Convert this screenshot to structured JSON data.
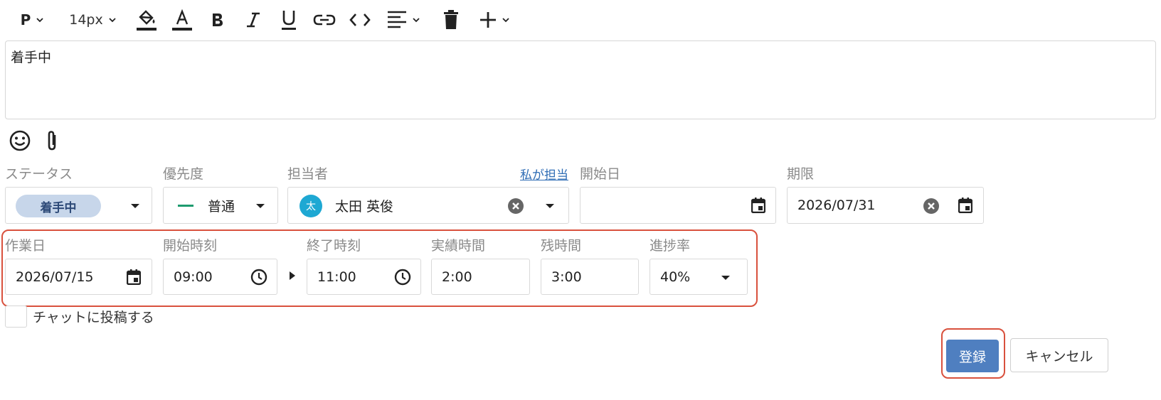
{
  "toolbar": {
    "paragraph_label": "P",
    "font_size_label": "14px"
  },
  "editor": {
    "content": "着手中"
  },
  "fields": {
    "status": {
      "label": "ステータス",
      "value": "着手中"
    },
    "priority": {
      "label": "優先度",
      "value": "普通"
    },
    "assignee": {
      "label": "担当者",
      "link": "私が担当",
      "avatar_initial": "太",
      "value": "太田 英俊"
    },
    "start_date": {
      "label": "開始日",
      "value": ""
    },
    "due_date": {
      "label": "期限",
      "value": "2026/07/31"
    },
    "work_date": {
      "label": "作業日",
      "value": "2026/07/15"
    },
    "start_time": {
      "label": "開始時刻",
      "value": "09:00"
    },
    "end_time": {
      "label": "終了時刻",
      "value": "11:00"
    },
    "actual_time": {
      "label": "実績時間",
      "value": "2:00"
    },
    "remaining_time": {
      "label": "残時間",
      "value": "3:00"
    },
    "progress": {
      "label": "進捗率",
      "value": "40%"
    }
  },
  "post_to_chat": {
    "label": "チャットに投稿する",
    "checked": false
  },
  "buttons": {
    "submit": "登録",
    "cancel": "キャンセル"
  },
  "colors": {
    "primary_button": "#4f7fc0",
    "status_chip": "#c7d6ea",
    "avatar": "#1ea8d3",
    "highlight": "#d9513d",
    "priority_dash": "#1e9b6f"
  }
}
